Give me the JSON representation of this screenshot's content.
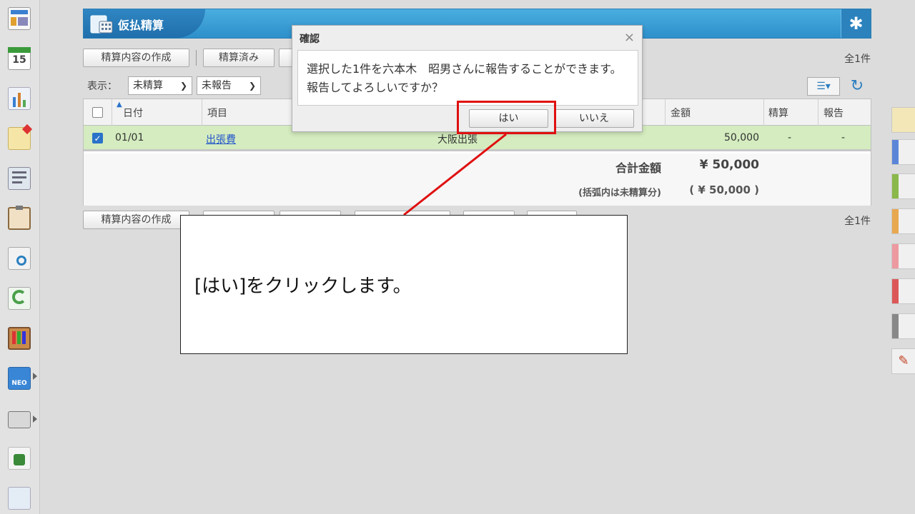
{
  "app": {
    "title": "仮払精算",
    "gear_icon": "gear-icon",
    "brand_color": "#2e8fca"
  },
  "toolbar_top": {
    "create_label": "精算内容の作成",
    "settled_label": "精算済み",
    "count": "全1件"
  },
  "filters": {
    "label": "表示：",
    "status_value": "未精算",
    "report_value": "未報告"
  },
  "table": {
    "headers": {
      "date": "日付",
      "item": "項目",
      "amount": "金額",
      "settle": "精算",
      "report": "報告"
    },
    "rows": [
      {
        "date": "01/01",
        "item": "出張費",
        "note": "大阪出張",
        "amount": "50,000",
        "settle": "-",
        "report": "-",
        "checked": true
      }
    ],
    "total_label": "合計金額",
    "total_value": "¥ 50,000",
    "unsettled_label": "(括弧内は未精算分)",
    "unsettled_value": "( ¥ 50,000 )"
  },
  "toolbar_bottom": {
    "create_label": "精算内容の作成",
    "count": "全1件"
  },
  "dialog": {
    "title": "確認",
    "message": "選択した1件を六本木　昭男さんに報告することができます。報告してよろしいですか？",
    "yes_label": "はい",
    "no_label": "いいえ"
  },
  "callout": {
    "text": "[はい]をクリックします。"
  }
}
